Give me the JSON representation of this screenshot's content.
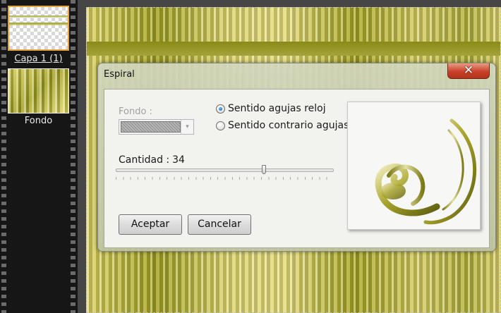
{
  "layers": {
    "items": [
      {
        "label": "Capa 1 (1)",
        "thumbnail": "transparent-lines",
        "selected": true
      },
      {
        "label": "Fondo",
        "thumbnail": "yellow-green-pattern",
        "selected": false
      }
    ]
  },
  "dialog": {
    "title": "Espiral",
    "close_icon": "close-x-icon",
    "close_glyph": "✕",
    "fondo_label": "Fondo :",
    "fondo_arrow": "▾",
    "radio_clockwise": "Sentido agujas reloj",
    "radio_counterclockwise": "Sentido contrario agujas",
    "selected_direction": "clockwise",
    "cantidad_label": "Cantidad :",
    "cantidad_value": "34",
    "slider_fraction": 0.68,
    "accept_label": "Aceptar",
    "cancel_label": "Cancelar"
  },
  "colors": {
    "selection_border": "#e8a33a",
    "close_button": "#c9412a",
    "accent_olive": "#8f901e",
    "accent_yellow": "#e2d98b"
  }
}
